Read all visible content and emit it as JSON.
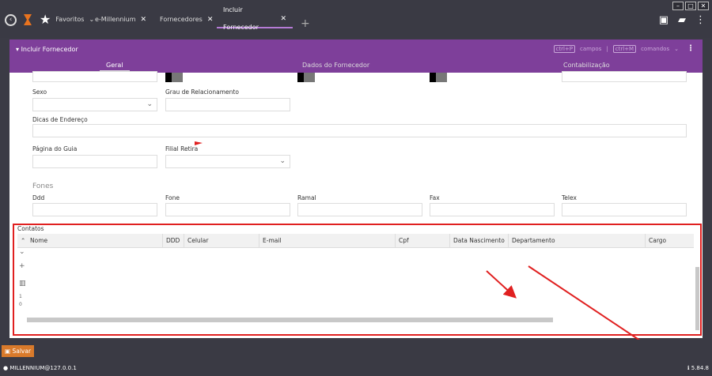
{
  "tabs": {
    "favoritos": "Favoritos",
    "emillennium": "e-Millennium",
    "fornecedores": "Fornecedores",
    "incluir": "Incluir Fornecedor"
  },
  "panel": {
    "title": "Incluir Fornecedor",
    "shortcut_key1": "ctrl+P",
    "shortcut_label1": "campos",
    "shortcut_sep": "|",
    "shortcut_key2": "ctrl+M",
    "shortcut_label2": "comandos",
    "sections": [
      "Geral",
      "Dados do Fornecedor",
      "Contabilização"
    ]
  },
  "form": {
    "sexo": "Sexo",
    "grau": "Grau de Relacionamento",
    "dicas": "Dicas de Endereço",
    "pagina": "Página do Guia",
    "filial": "Filial Retira",
    "fones": "Fones",
    "ddd": "Ddd",
    "fone": "Fone",
    "ramal": "Ramal",
    "fax": "Fax",
    "telex": "Telex"
  },
  "contatos": {
    "title": "Contatos",
    "columns": [
      "Nome",
      "DDD",
      "Celular",
      "E-mail",
      "Cpf",
      "Data Nascimento",
      "Departamento",
      "Cargo"
    ],
    "tool_count": "1",
    "tool_zero": "0"
  },
  "bottom": {
    "save": "Salvar",
    "user": "MILLENNIUM@127.0.0.1",
    "version": "5.84.8"
  },
  "colors": {
    "header": "#7e3f9a",
    "highlight": "#e02020",
    "save": "#d97a2b"
  }
}
